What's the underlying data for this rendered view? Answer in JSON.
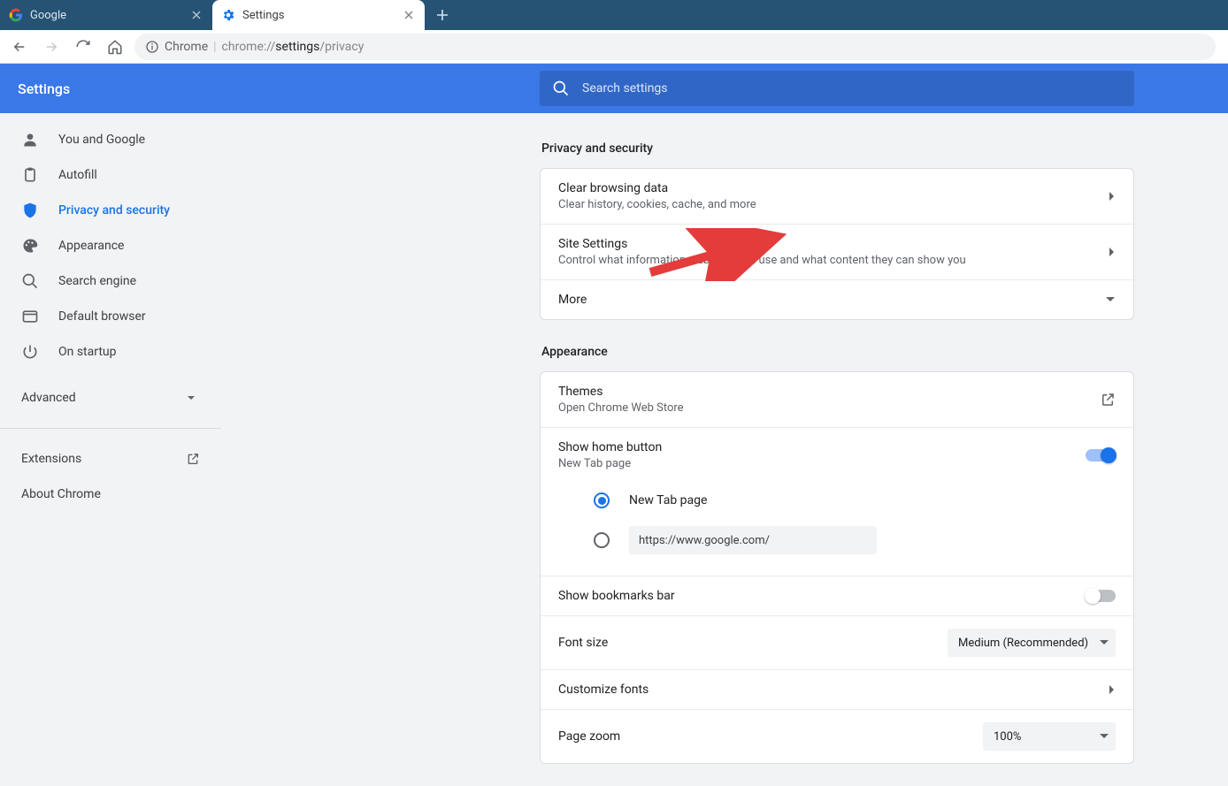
{
  "tabs": {
    "inactive": "Google",
    "active": "Settings"
  },
  "omnibox": {
    "chip": "Chrome",
    "prefix": "chrome://",
    "bold": "settings",
    "suffix": "/privacy"
  },
  "app": {
    "title": "Settings"
  },
  "search": {
    "placeholder": "Search settings"
  },
  "sidebar": {
    "items": [
      {
        "label": "You and Google"
      },
      {
        "label": "Autofill"
      },
      {
        "label": "Privacy and security"
      },
      {
        "label": "Appearance"
      },
      {
        "label": "Search engine"
      },
      {
        "label": "Default browser"
      },
      {
        "label": "On startup"
      }
    ],
    "advanced": "Advanced",
    "extensions": "Extensions",
    "about": "About Chrome"
  },
  "privacy": {
    "section": "Privacy and security",
    "rows": [
      {
        "title": "Clear browsing data",
        "sub": "Clear history, cookies, cache, and more"
      },
      {
        "title": "Site Settings",
        "sub": "Control what information websites can use and what content they can show you"
      },
      {
        "title": "More"
      }
    ]
  },
  "appearance": {
    "section": "Appearance",
    "themes": {
      "title": "Themes",
      "sub": "Open Chrome Web Store"
    },
    "homebtn": {
      "title": "Show home button",
      "sub": "New Tab page",
      "option1": "New Tab page",
      "url": "https://www.google.com/"
    },
    "bookmarks": {
      "title": "Show bookmarks bar"
    },
    "fontsize": {
      "title": "Font size",
      "value": "Medium (Recommended)"
    },
    "customfonts": {
      "title": "Customize fonts"
    },
    "zoom": {
      "title": "Page zoom",
      "value": "100%"
    }
  }
}
